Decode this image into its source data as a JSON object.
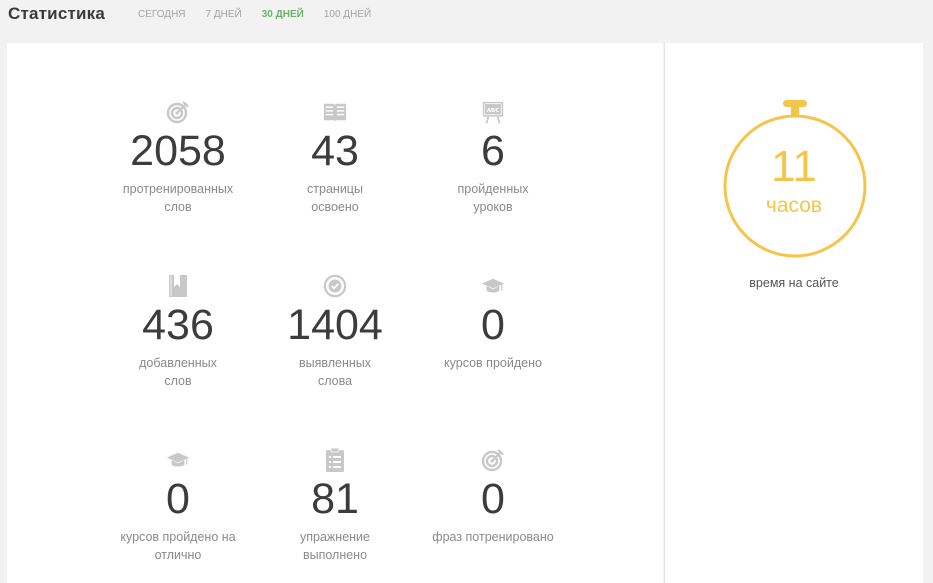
{
  "header": {
    "title": "Статистика",
    "tabs": [
      {
        "label": "СЕГОДНЯ",
        "active": false
      },
      {
        "label": "7 ДНЕЙ",
        "active": false
      },
      {
        "label": "30 ДНЕЙ",
        "active": true
      },
      {
        "label": "100 ДНЕЙ",
        "active": false
      }
    ]
  },
  "colors": {
    "active_tab": "#6bb36b",
    "timer": "#f4c54a",
    "icon": "#c8c8c8"
  },
  "stats": [
    {
      "icon": "target-icon",
      "value": "2058",
      "label_lines": [
        "протренированных",
        "слов"
      ]
    },
    {
      "icon": "book-icon",
      "value": "43",
      "label_lines": [
        "страницы",
        "освоено"
      ]
    },
    {
      "icon": "board-icon",
      "icon_text": "ABC",
      "value": "6",
      "label_lines": [
        "пройденных",
        "уроков"
      ]
    },
    {
      "icon": "bookmark-book-icon",
      "value": "436",
      "label_lines": [
        "добавленных",
        "слов"
      ]
    },
    {
      "icon": "check-circle-icon",
      "value": "1404",
      "label_lines": [
        "выявленных",
        "слова"
      ]
    },
    {
      "icon": "graduation-cap-icon",
      "value": "0",
      "label_lines": [
        "курсов пройдено"
      ]
    },
    {
      "icon": "graduation-cap-icon",
      "value": "0",
      "label_lines": [
        "курсов пройдено на",
        "отлично"
      ]
    },
    {
      "icon": "clipboard-icon",
      "value": "81",
      "label_lines": [
        "упражнение",
        "выполнено"
      ]
    },
    {
      "icon": "target-icon",
      "value": "0",
      "label_lines": [
        "фраз потренировано"
      ]
    }
  ],
  "time_on_site": {
    "value": "11",
    "unit": "часов",
    "caption": "время на сайте"
  }
}
